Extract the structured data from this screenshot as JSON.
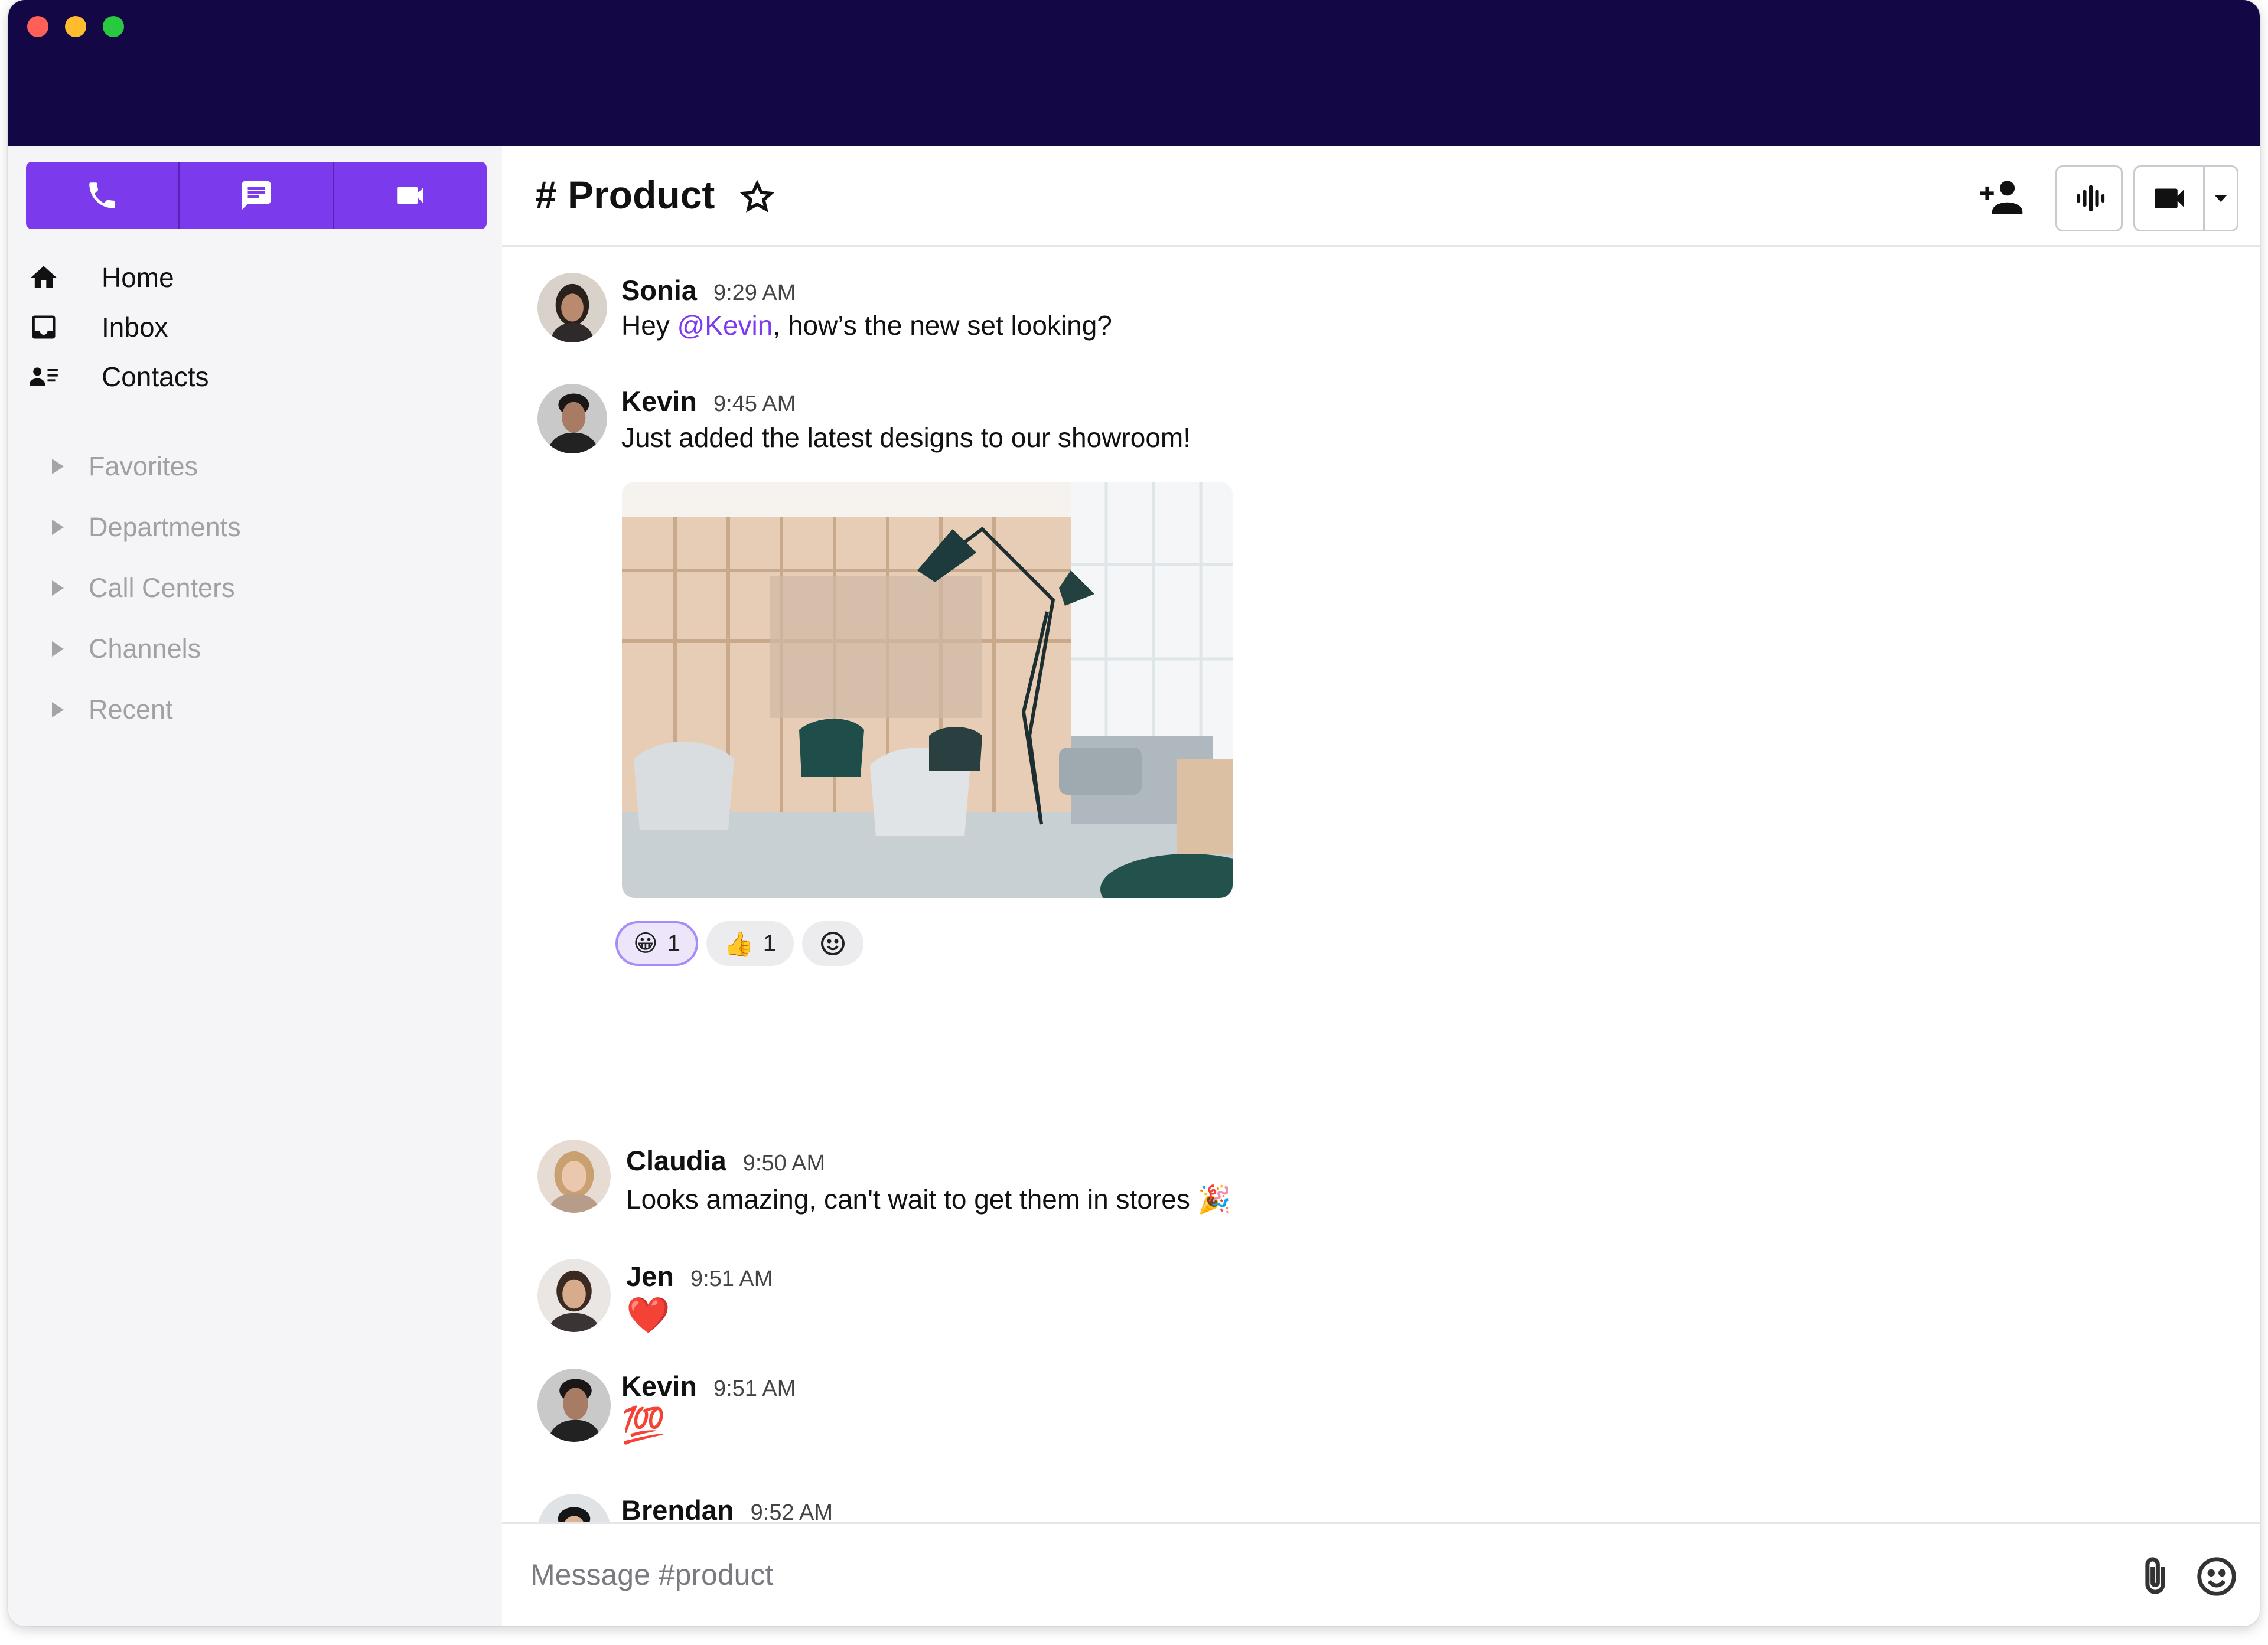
{
  "sidebar": {
    "modes": [
      {
        "name": "phone-icon"
      },
      {
        "name": "chat-icon"
      },
      {
        "name": "video-camera-icon"
      }
    ],
    "nav": [
      {
        "label": "Home",
        "icon": "home-icon"
      },
      {
        "label": "Inbox",
        "icon": "inbox-icon"
      },
      {
        "label": "Contacts",
        "icon": "contacts-icon"
      }
    ],
    "groups": [
      {
        "label": "Favorites"
      },
      {
        "label": "Departments"
      },
      {
        "label": "Call Centers"
      },
      {
        "label": "Channels"
      },
      {
        "label": "Recent"
      }
    ]
  },
  "channel": {
    "title": "# Product",
    "star_icon": "star-outline-icon"
  },
  "header_actions": {
    "add_user_icon": "person-add-icon",
    "audio_icon": "audio-waveform-icon",
    "video_icon": "video-camera-icon",
    "dropdown_icon": "caret-down-icon"
  },
  "messages": [
    {
      "author": "Sonia",
      "time": "9:29 AM",
      "text_pre": "Hey ",
      "mention": "@Kevin",
      "text_post": ", how’s the new set looking?"
    },
    {
      "author": "Kevin",
      "time": "9:45 AM",
      "text": "Just added the latest designs to our showroom!"
    },
    {
      "author": "Claudia",
      "time": "9:50 AM",
      "text": "Looks amazing, can't wait to get them in stores",
      "emoji": "🎉"
    },
    {
      "author": "Jen",
      "time": "9:51 AM",
      "emoji": "❤️"
    },
    {
      "author": "Kevin",
      "time": "9:51 AM",
      "emoji": "💯"
    },
    {
      "author": "Brendan",
      "time": "9:52 AM",
      "emoji": "🎉"
    }
  ],
  "reactions": [
    {
      "emoji": "😀",
      "count": "1",
      "active": true
    },
    {
      "emoji": "👍",
      "count": "1",
      "active": false
    }
  ],
  "composer": {
    "placeholder": "Message #product",
    "attach_icon": "paperclip-icon",
    "emoji_icon": "smiley-icon"
  },
  "colors": {
    "titlebar": "#140746",
    "accent": "#7c3aed",
    "sidebar_bg": "#f5f5f7"
  }
}
